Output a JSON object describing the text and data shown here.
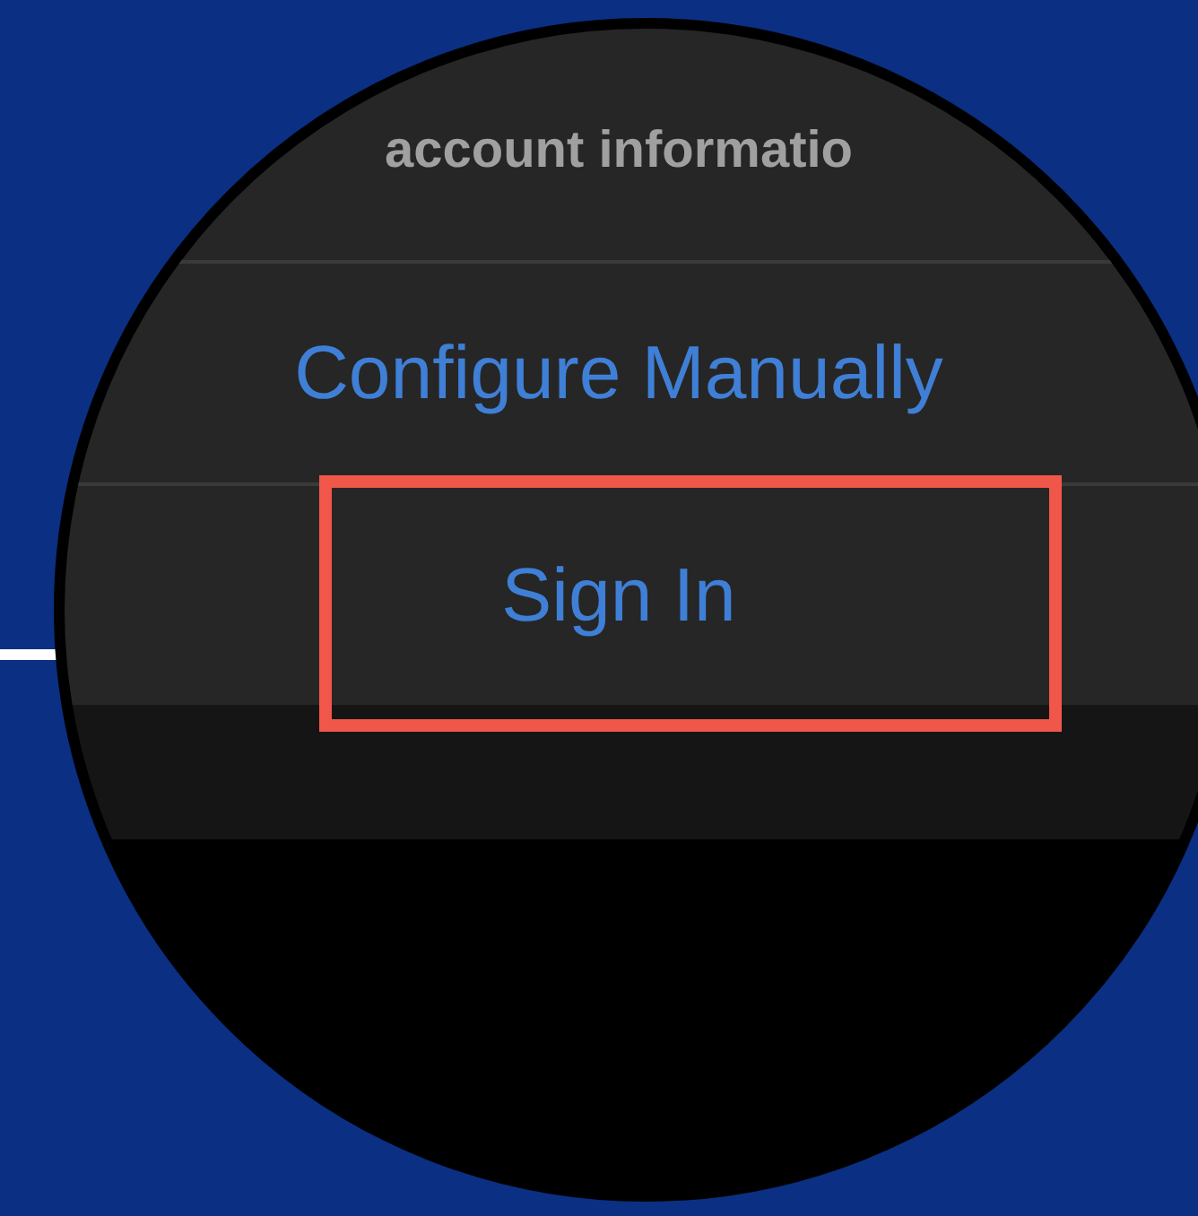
{
  "magnifier": {
    "message": "account informatio",
    "buttons": [
      {
        "label": "Configure Manually",
        "highlighted": false
      },
      {
        "label": "Sign In",
        "highlighted": true
      }
    ]
  }
}
